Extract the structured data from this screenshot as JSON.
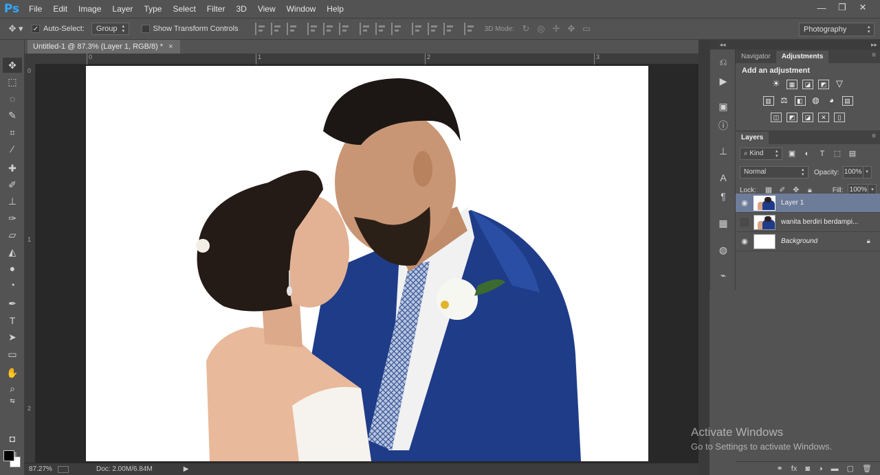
{
  "app": {
    "logo": "Ps"
  },
  "menu": [
    "File",
    "Edit",
    "Image",
    "Layer",
    "Type",
    "Select",
    "Filter",
    "3D",
    "View",
    "Window",
    "Help"
  ],
  "window_controls": {
    "minimize": "—",
    "restore": "❐",
    "close": "✕"
  },
  "options": {
    "auto_select_label": "Auto-Select:",
    "auto_select_checked": true,
    "auto_select_mode": "Group",
    "transform_label": "Show Transform Controls",
    "transform_checked": false,
    "mode_label": "3D Mode:",
    "workspace": "Photography"
  },
  "document": {
    "tab_title": "Untitled-1 @ 87.3% (Layer 1, RGB/8) *",
    "tab_close": "×",
    "ruler_h": [
      "0",
      "1",
      "2",
      "3"
    ],
    "ruler_v": [
      "0",
      "1",
      "2"
    ]
  },
  "status": {
    "zoom": "87.27%",
    "doc": "Doc: 2.00M/6.84M",
    "arrow": "▶"
  },
  "panels": {
    "top_tabs": [
      "Navigator",
      "Adjustments"
    ],
    "active_top_tab": "Adjustments",
    "adjustments_title": "Add an adjustment",
    "adjustment_rows": [
      [
        "☀",
        "▦",
        "◪",
        "◩",
        "▽"
      ],
      [
        "▥",
        "⚖",
        "◧",
        "◍",
        "◕",
        "▤"
      ],
      [
        "◫",
        "◩",
        "◪",
        "✕",
        "▯"
      ]
    ],
    "layers_tab": "Layers",
    "kind_label": "Kind",
    "blend_mode": "Normal",
    "opacity_label": "Opacity:",
    "opacity_value": "100%",
    "lock_label": "Lock:",
    "fill_label": "Fill:",
    "fill_value": "100%",
    "layers": [
      {
        "name": "Layer 1",
        "visible": true,
        "selected": true,
        "type": "photo"
      },
      {
        "name": "wanita berdiri berdampi...",
        "visible": false,
        "selected": false,
        "type": "smart"
      },
      {
        "name": "Background",
        "visible": true,
        "selected": false,
        "type": "white",
        "locked": true
      }
    ]
  },
  "watermark": {
    "line1": "Activate Windows",
    "line2": "Go to Settings to activate Windows."
  },
  "colors": {
    "accent_ps": "#31a8ff",
    "selection": "#6d7c99",
    "suit": "#1f3c88"
  }
}
